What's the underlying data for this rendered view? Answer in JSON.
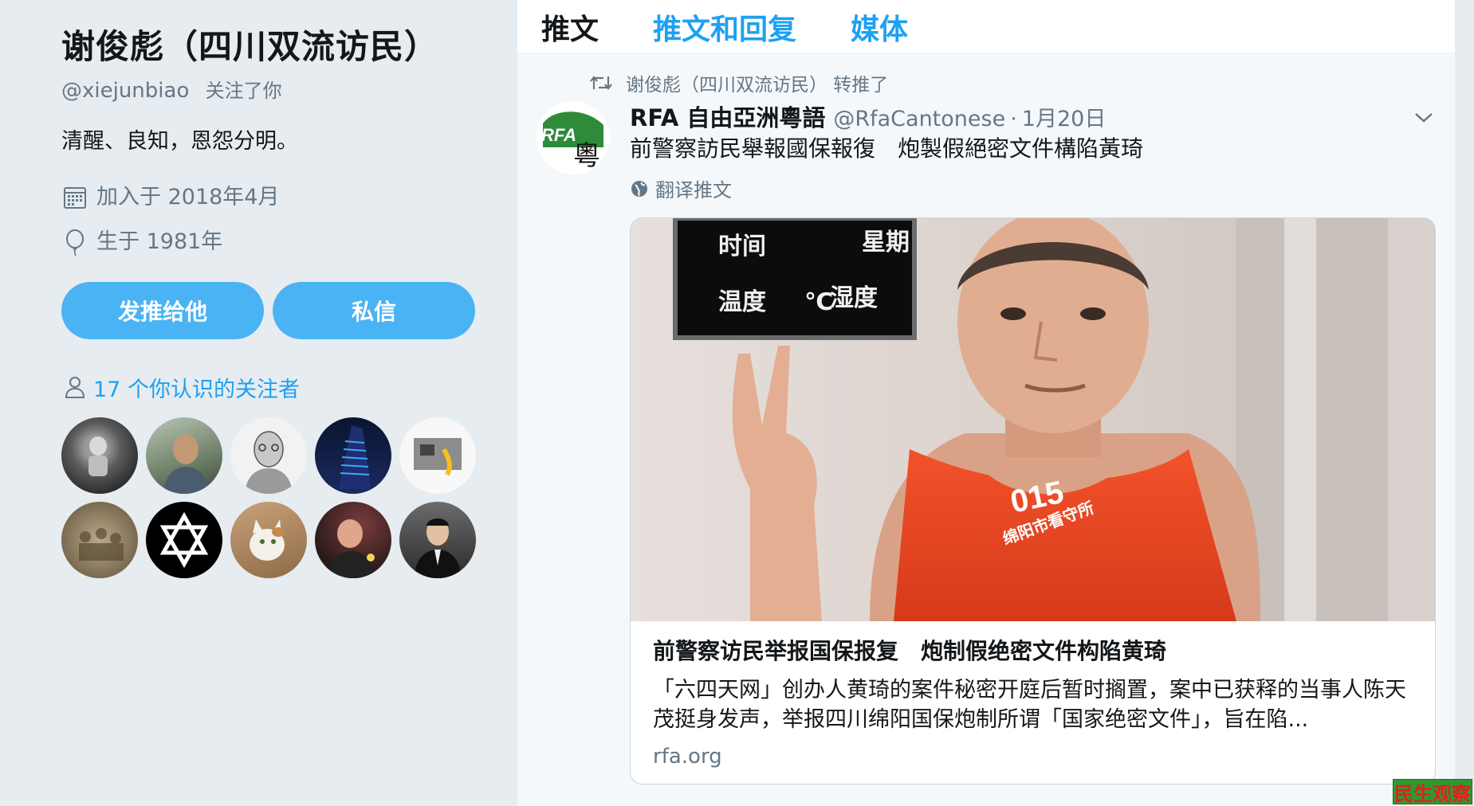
{
  "profile": {
    "name": "谢俊彪（四川双流访民）",
    "handle": "@xiejunbiao",
    "follows_you": "关注了你",
    "bio": "清醒、良知，恩怨分明。",
    "joined": "加入于 2018年4月",
    "born": "生于 1981年",
    "buttons": {
      "tweet_to": "发推给他",
      "message": "私信"
    },
    "followers_you_know": "17 个你认识的关注者"
  },
  "tabs": [
    "推文",
    "推文和回复",
    "媒体"
  ],
  "active_tab": "推文",
  "tweet": {
    "retweeted_by": "谢俊彪（四川双流访民） 转推了",
    "author": "RFA 自由亞洲粵語",
    "handle": "@RfaCantonese",
    "separator": "·",
    "date": "1月20日",
    "text": "前警察訪民舉報國保報復　炮製假絕密文件構陷黃琦",
    "translate": "翻译推文",
    "card": {
      "image_sign": {
        "time": "时间",
        "week": "星期",
        "temp": "温度",
        "unit": "℃",
        "humidity": "湿度"
      },
      "vest_number": "015",
      "vest_text": "绵阳市看守所",
      "title": "前警察访民举报国保报复　炮制假绝密文件构陷黄琦",
      "description": "「六四天网」创办人黄琦的案件秘密开庭后暂时搁置，案中已获释的当事人陈天茂挺身发声，举报四川绵阳国保炮制所谓「国家绝密文件」，旨在陷...",
      "domain": "rfa.org"
    }
  },
  "rfa_logo_text": "RFA",
  "rfa_logo_char": "粵",
  "watermark": "民生观察",
  "colors": {
    "link": "#1da1f2",
    "button": "#4ab3f4",
    "muted": "#657786",
    "background": "#e6ecf0"
  }
}
